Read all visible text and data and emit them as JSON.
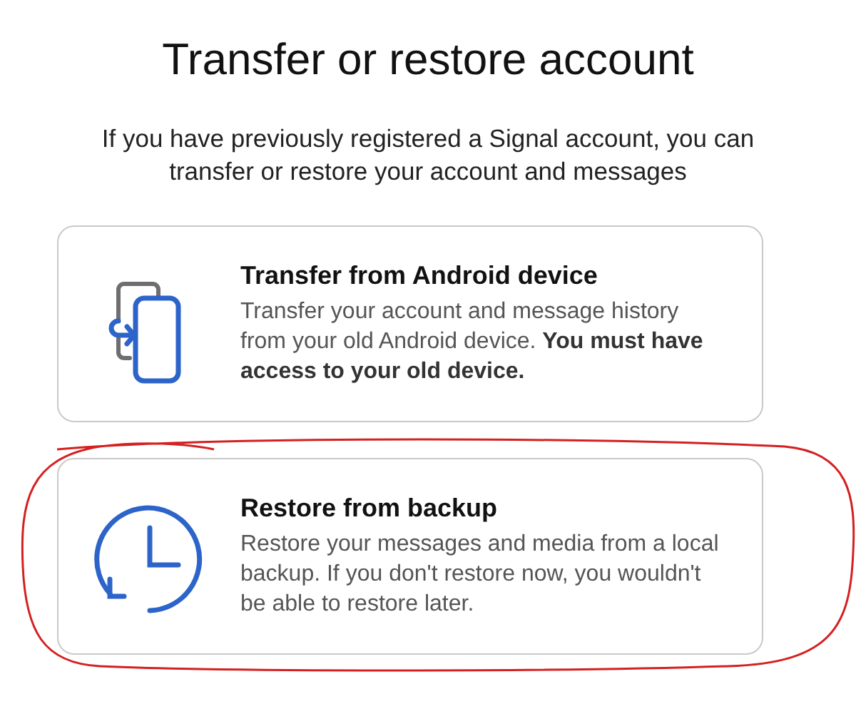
{
  "title": "Transfer or restore account",
  "subtitle": "If you have previously registered a Signal account, you can transfer or restore your account and messages",
  "options": [
    {
      "kind": "device",
      "title": "Transfer from Android device",
      "description": "Transfer your account and message history from your old Android device. **You must have access to your old device.**",
      "circled": false
    },
    {
      "kind": "backup",
      "title": "Restore from backup",
      "description": "Restore your messages and media from a local backup. If you don't restore now, you wouldn't be able to restore later.",
      "circled": true
    }
  ]
}
